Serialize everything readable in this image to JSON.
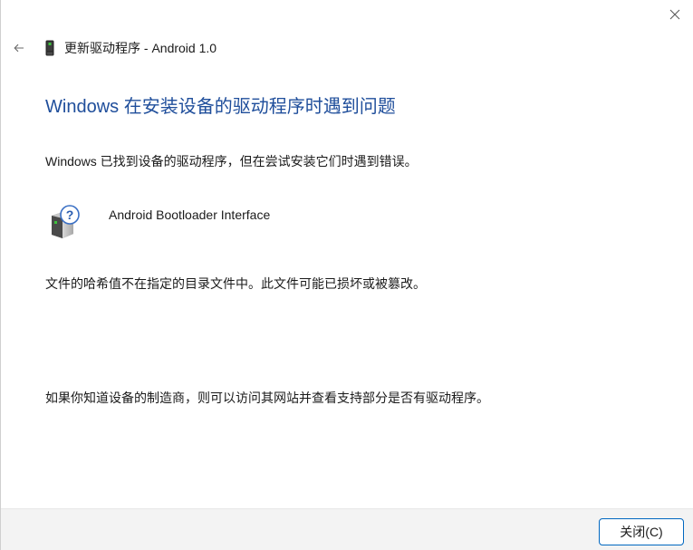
{
  "window": {
    "close_icon": "close-icon"
  },
  "header": {
    "back_icon": "back-arrow-icon",
    "device_icon": "usb-device-icon",
    "title": "更新驱动程序 - Android 1.0"
  },
  "main": {
    "heading": "Windows 在安装设备的驱动程序时遇到问题",
    "found_text": "Windows 已找到设备的驱动程序，但在尝试安装它们时遇到错误。",
    "device": {
      "icon": "unknown-device-icon",
      "name": "Android Bootloader Interface"
    },
    "error_text": "文件的哈希值不在指定的目录文件中。此文件可能已损坏或被篡改。",
    "advice_text": "如果你知道设备的制造商，则可以访问其网站并查看支持部分是否有驱动程序。"
  },
  "footer": {
    "close_label": "关闭(C)"
  },
  "colors": {
    "heading": "#1f4e9b",
    "accent_border": "#0067c0",
    "footer_bg": "#f3f3f3"
  }
}
